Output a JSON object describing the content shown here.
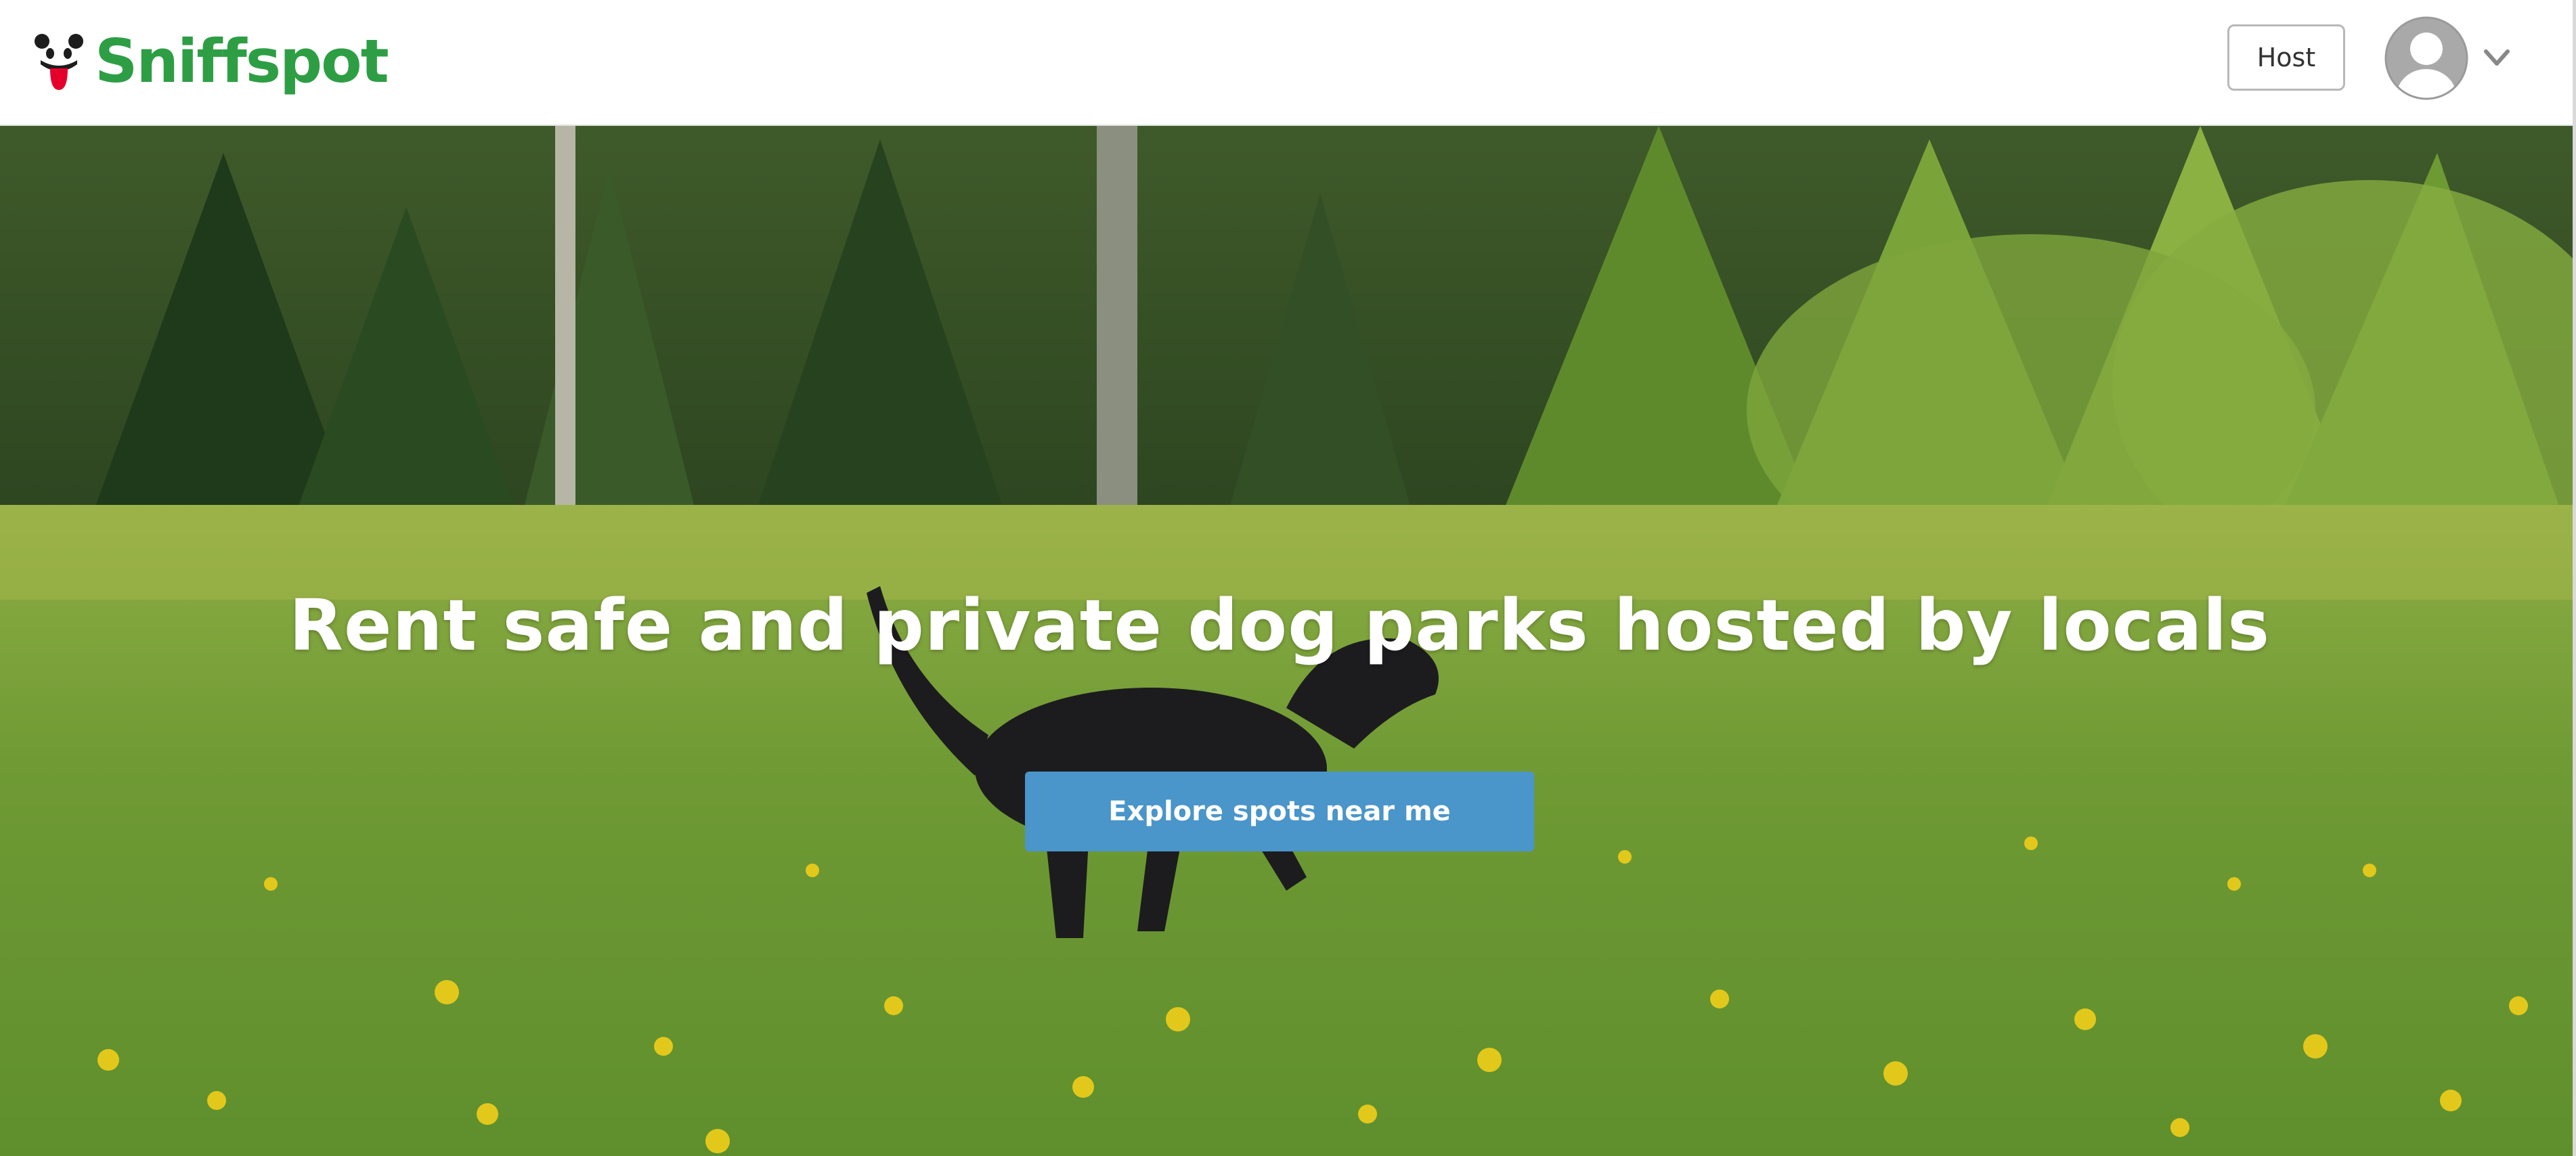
{
  "brand": {
    "name": "Sniffspot",
    "logo_icon": "dog-face-icon",
    "color": "#2e9e45"
  },
  "header": {
    "host_label": "Host",
    "avatar_icon": "user-avatar-icon",
    "menu_icon": "chevron-down-icon"
  },
  "hero": {
    "headline": "Rent safe and private dog parks hosted by locals",
    "cta_label": "Explore spots near me",
    "cta_color": "#4a95c9",
    "background": "photo of a black dog running through a grassy field with yellow dandelions and evergreen trees"
  }
}
